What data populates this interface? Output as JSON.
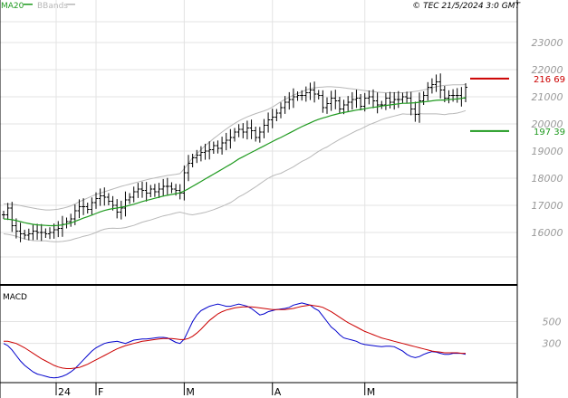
{
  "header": {
    "legend_ma": "MA20",
    "legend_bb": "BBands",
    "copyright": "© TEC 21/5/2024 3:0 GMT"
  },
  "colors": {
    "ma": "#1f9a1f",
    "bands": "#b8b8b8",
    "price_bars": "#000000",
    "resistance": "#cc0000",
    "support": "#1f9a1f",
    "macd": "#0000cc",
    "signal": "#cc0000",
    "grid": "#e3e3e3",
    "axis_text": "#999999"
  },
  "chart_data": [
    {
      "type": "line",
      "panel": "price",
      "ylim": [
        14100,
        24100
      ],
      "yticks": [
        "16000",
        "17000",
        "18000",
        "19000",
        "20000",
        "21000",
        "22000",
        "23000"
      ],
      "xtick_labels": [
        "24",
        "F",
        "M",
        "A",
        "M"
      ],
      "x_start": "2024-01-02",
      "levels": [
        {
          "label": "216 69",
          "value": 21669,
          "color": "#cc0000"
        },
        {
          "label": "197 39",
          "value": 19739,
          "color": "#1f9a1f"
        }
      ],
      "close": [
        16650,
        16900,
        16250,
        16050,
        15950,
        15900,
        15950,
        16050,
        16000,
        16000,
        15950,
        16000,
        16100,
        16150,
        16300,
        16400,
        16500,
        16800,
        16950,
        16950,
        16850,
        17100,
        17250,
        17350,
        17300,
        17150,
        17000,
        16750,
        16900,
        17200,
        17300,
        17500,
        17600,
        17550,
        17450,
        17600,
        17500,
        17600,
        17700,
        17700,
        17600,
        17550,
        17450,
        18200,
        18550,
        18750,
        18850,
        18950,
        19000,
        19050,
        19200,
        19100,
        19300,
        19400,
        19500,
        19700,
        19800,
        19700,
        19850,
        19750,
        19500,
        19700,
        19950,
        20150,
        20250,
        20400,
        20600,
        20800,
        20900,
        21000,
        21050,
        21050,
        21150,
        21250,
        21100,
        21050,
        20600,
        20750,
        20950,
        20850,
        20550,
        20700,
        20800,
        20900,
        20950,
        20650,
        20950,
        21000,
        20850,
        20700,
        20700,
        20950,
        20800,
        20900,
        20900,
        21000,
        20950,
        20550,
        20350,
        20850,
        21050,
        21350,
        21450,
        21550,
        21250,
        20950,
        21050,
        21050,
        21050,
        20950,
        21350
      ],
      "series": [
        {
          "name": "MA20",
          "values": [
            16500,
            16490,
            16470,
            16440,
            16400,
            16360,
            16330,
            16300,
            16280,
            16270,
            16260,
            16250,
            16250,
            16260,
            16280,
            16310,
            16350,
            16410,
            16470,
            16530,
            16580,
            16640,
            16700,
            16760,
            16810,
            16850,
            16880,
            16900,
            16930,
            16960,
            17000,
            17040,
            17090,
            17140,
            17180,
            17220,
            17260,
            17300,
            17340,
            17370,
            17400,
            17430,
            17460,
            17530,
            17610,
            17700,
            17790,
            17880,
            17970,
            18060,
            18150,
            18240,
            18330,
            18420,
            18510,
            18610,
            18710,
            18790,
            18870,
            18950,
            19030,
            19110,
            19190,
            19270,
            19350,
            19430,
            19500,
            19580,
            19660,
            19740,
            19820,
            19900,
            19970,
            20040,
            20110,
            20170,
            20220,
            20260,
            20310,
            20350,
            20390,
            20420,
            20450,
            20480,
            20510,
            20530,
            20560,
            20590,
            20610,
            20630,
            20660,
            20680,
            20700,
            20720,
            20740,
            20760,
            20760,
            20770,
            20780,
            20800,
            20810,
            20830,
            20850,
            20870,
            20880,
            20880,
            20900,
            20910,
            20920,
            20940,
            20970
          ]
        },
        {
          "name": "BBands upper",
          "values": [
            17050,
            17050,
            17040,
            17020,
            16990,
            16960,
            16930,
            16900,
            16870,
            16850,
            16830,
            16830,
            16840,
            16860,
            16890,
            16930,
            16980,
            17050,
            17130,
            17200,
            17270,
            17340,
            17400,
            17450,
            17500,
            17550,
            17600,
            17650,
            17700,
            17740,
            17780,
            17820,
            17860,
            17900,
            17940,
            17980,
            18010,
            18040,
            18070,
            18100,
            18120,
            18140,
            18170,
            18350,
            18550,
            18750,
            18900,
            19050,
            19200,
            19330,
            19460,
            19580,
            19700,
            19810,
            19920,
            20020,
            20110,
            20190,
            20260,
            20320,
            20380,
            20430,
            20480,
            20540,
            20620,
            20720,
            20820,
            20900,
            20980,
            21060,
            21120,
            21180,
            21250,
            21300,
            21330,
            21350,
            21360,
            21370,
            21370,
            21360,
            21350,
            21330,
            21310,
            21290,
            21270,
            21250,
            21230,
            21210,
            21190,
            21170,
            21160,
            21150,
            21150,
            21150,
            21150,
            21150,
            21160,
            21180,
            21200,
            21220,
            21250,
            21290,
            21330,
            21370,
            21400,
            21420,
            21430,
            21440,
            21440,
            21440,
            21450
          ]
        },
        {
          "name": "BBands lower",
          "values": [
            15950,
            15930,
            15900,
            15860,
            15810,
            15760,
            15730,
            15700,
            15690,
            15690,
            15690,
            15670,
            15660,
            15660,
            15670,
            15690,
            15720,
            15770,
            15810,
            15860,
            15890,
            15940,
            16000,
            16070,
            16120,
            16150,
            16160,
            16150,
            16160,
            16180,
            16220,
            16260,
            16320,
            16380,
            16420,
            16460,
            16510,
            16560,
            16610,
            16640,
            16680,
            16720,
            16750,
            16710,
            16670,
            16650,
            16680,
            16710,
            16740,
            16790,
            16840,
            16900,
            16960,
            17030,
            17100,
            17200,
            17310,
            17390,
            17480,
            17580,
            17680,
            17790,
            17900,
            18000,
            18080,
            18140,
            18180,
            18260,
            18340,
            18420,
            18520,
            18620,
            18690,
            18780,
            18890,
            18990,
            19080,
            19150,
            19250,
            19340,
            19430,
            19510,
            19590,
            19670,
            19750,
            19810,
            19890,
            19970,
            20030,
            20090,
            20160,
            20210,
            20250,
            20290,
            20330,
            20370,
            20360,
            20360,
            20360,
            20380,
            20370,
            20370,
            20370,
            20370,
            20360,
            20340,
            20370,
            20380,
            20400,
            20440,
            20490
          ]
        }
      ]
    },
    {
      "type": "line",
      "panel": "macd",
      "title": "MACD",
      "ylim": [
        -50,
        810
      ],
      "yticks": [
        "300",
        "500"
      ],
      "series": [
        {
          "name": "MACD",
          "values": [
            300,
            280,
            240,
            190,
            140,
            100,
            70,
            40,
            20,
            10,
            0,
            -10,
            -15,
            -10,
            0,
            15,
            40,
            70,
            110,
            150,
            190,
            230,
            260,
            280,
            300,
            310,
            315,
            320,
            310,
            300,
            315,
            330,
            335,
            340,
            340,
            345,
            350,
            355,
            355,
            350,
            330,
            310,
            300,
            340,
            420,
            500,
            560,
            600,
            620,
            640,
            650,
            660,
            650,
            640,
            640,
            650,
            660,
            650,
            640,
            620,
            590,
            560,
            570,
            590,
            600,
            610,
            615,
            620,
            630,
            650,
            660,
            670,
            660,
            650,
            620,
            600,
            550,
            500,
            450,
            420,
            380,
            350,
            340,
            330,
            320,
            300,
            290,
            285,
            280,
            275,
            270,
            275,
            275,
            270,
            250,
            230,
            200,
            180,
            170,
            180,
            200,
            215,
            225,
            220,
            210,
            200,
            200,
            210,
            210,
            210,
            200
          ]
        },
        {
          "name": "Signal",
          "values": [
            320,
            320,
            310,
            300,
            280,
            260,
            235,
            210,
            185,
            160,
            140,
            120,
            100,
            85,
            75,
            70,
            70,
            75,
            80,
            95,
            110,
            130,
            150,
            170,
            190,
            210,
            230,
            250,
            265,
            280,
            290,
            300,
            310,
            320,
            325,
            330,
            335,
            340,
            345,
            345,
            345,
            340,
            335,
            335,
            345,
            365,
            395,
            430,
            470,
            510,
            540,
            570,
            590,
            605,
            615,
            625,
            630,
            635,
            635,
            635,
            630,
            625,
            620,
            615,
            610,
            610,
            610,
            610,
            615,
            620,
            630,
            640,
            645,
            650,
            645,
            640,
            630,
            610,
            590,
            565,
            540,
            515,
            490,
            470,
            450,
            430,
            410,
            395,
            380,
            365,
            350,
            340,
            330,
            320,
            310,
            300,
            290,
            280,
            270,
            260,
            250,
            240,
            230,
            225,
            220,
            215,
            215,
            215,
            215,
            210,
            210
          ]
        }
      ]
    }
  ]
}
